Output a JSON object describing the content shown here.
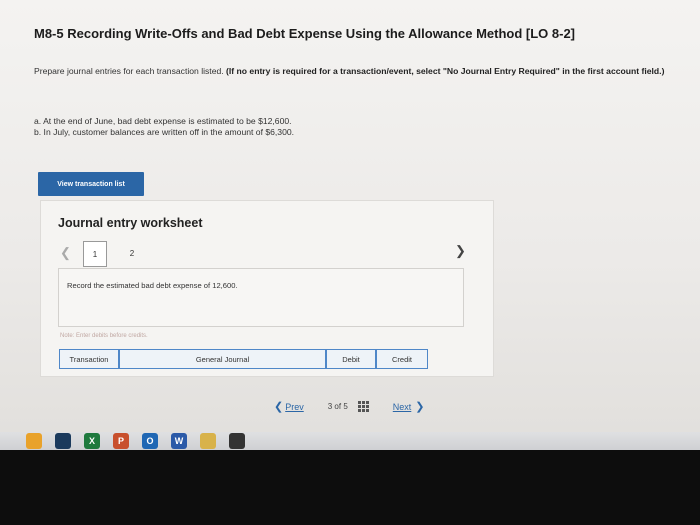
{
  "header": {
    "title": "M8-5 Recording Write-Offs and Bad Debt Expense Using the Allowance Method [LO 8-2]"
  },
  "instructions": {
    "text": "Prepare journal entries for each transaction listed. ",
    "bold": "(If no entry is required for a transaction/event, select \"No Journal Entry Required\" in the first account field.)"
  },
  "transactions": [
    "a. At the end of June, bad debt expense is estimated to be $12,600.",
    "b. In July, customer balances are written off in the amount of $6,300."
  ],
  "view_button": {
    "label": "View transaction list"
  },
  "worksheet": {
    "title": "Journal entry worksheet",
    "tabs": [
      "1",
      "2"
    ],
    "record_text": "Record the estimated bad debt expense of 12,600.",
    "note": "Note: Enter debits before credits.",
    "columns": [
      "Transaction",
      "General Journal",
      "Debit",
      "Credit"
    ]
  },
  "nav": {
    "prev_label": "Prev",
    "current": "3",
    "of": "of",
    "total": "5",
    "next_label": "Next"
  },
  "taskbar": {
    "icons": [
      {
        "name": "chrome-icon",
        "color": "#e9a22a"
      },
      {
        "name": "steam-icon",
        "color": "#1b3a5c"
      },
      {
        "name": "excel-icon",
        "color": "#1f7a3e",
        "glyph": "X"
      },
      {
        "name": "powerpoint-icon",
        "color": "#c8502d",
        "glyph": "P"
      },
      {
        "name": "outlook-icon",
        "color": "#1f67b4",
        "glyph": "O"
      },
      {
        "name": "word-icon",
        "color": "#2b5aa8",
        "glyph": "W"
      },
      {
        "name": "folder-icon",
        "color": "#d8b24a"
      },
      {
        "name": "terminal-icon",
        "color": "#333333"
      }
    ]
  }
}
